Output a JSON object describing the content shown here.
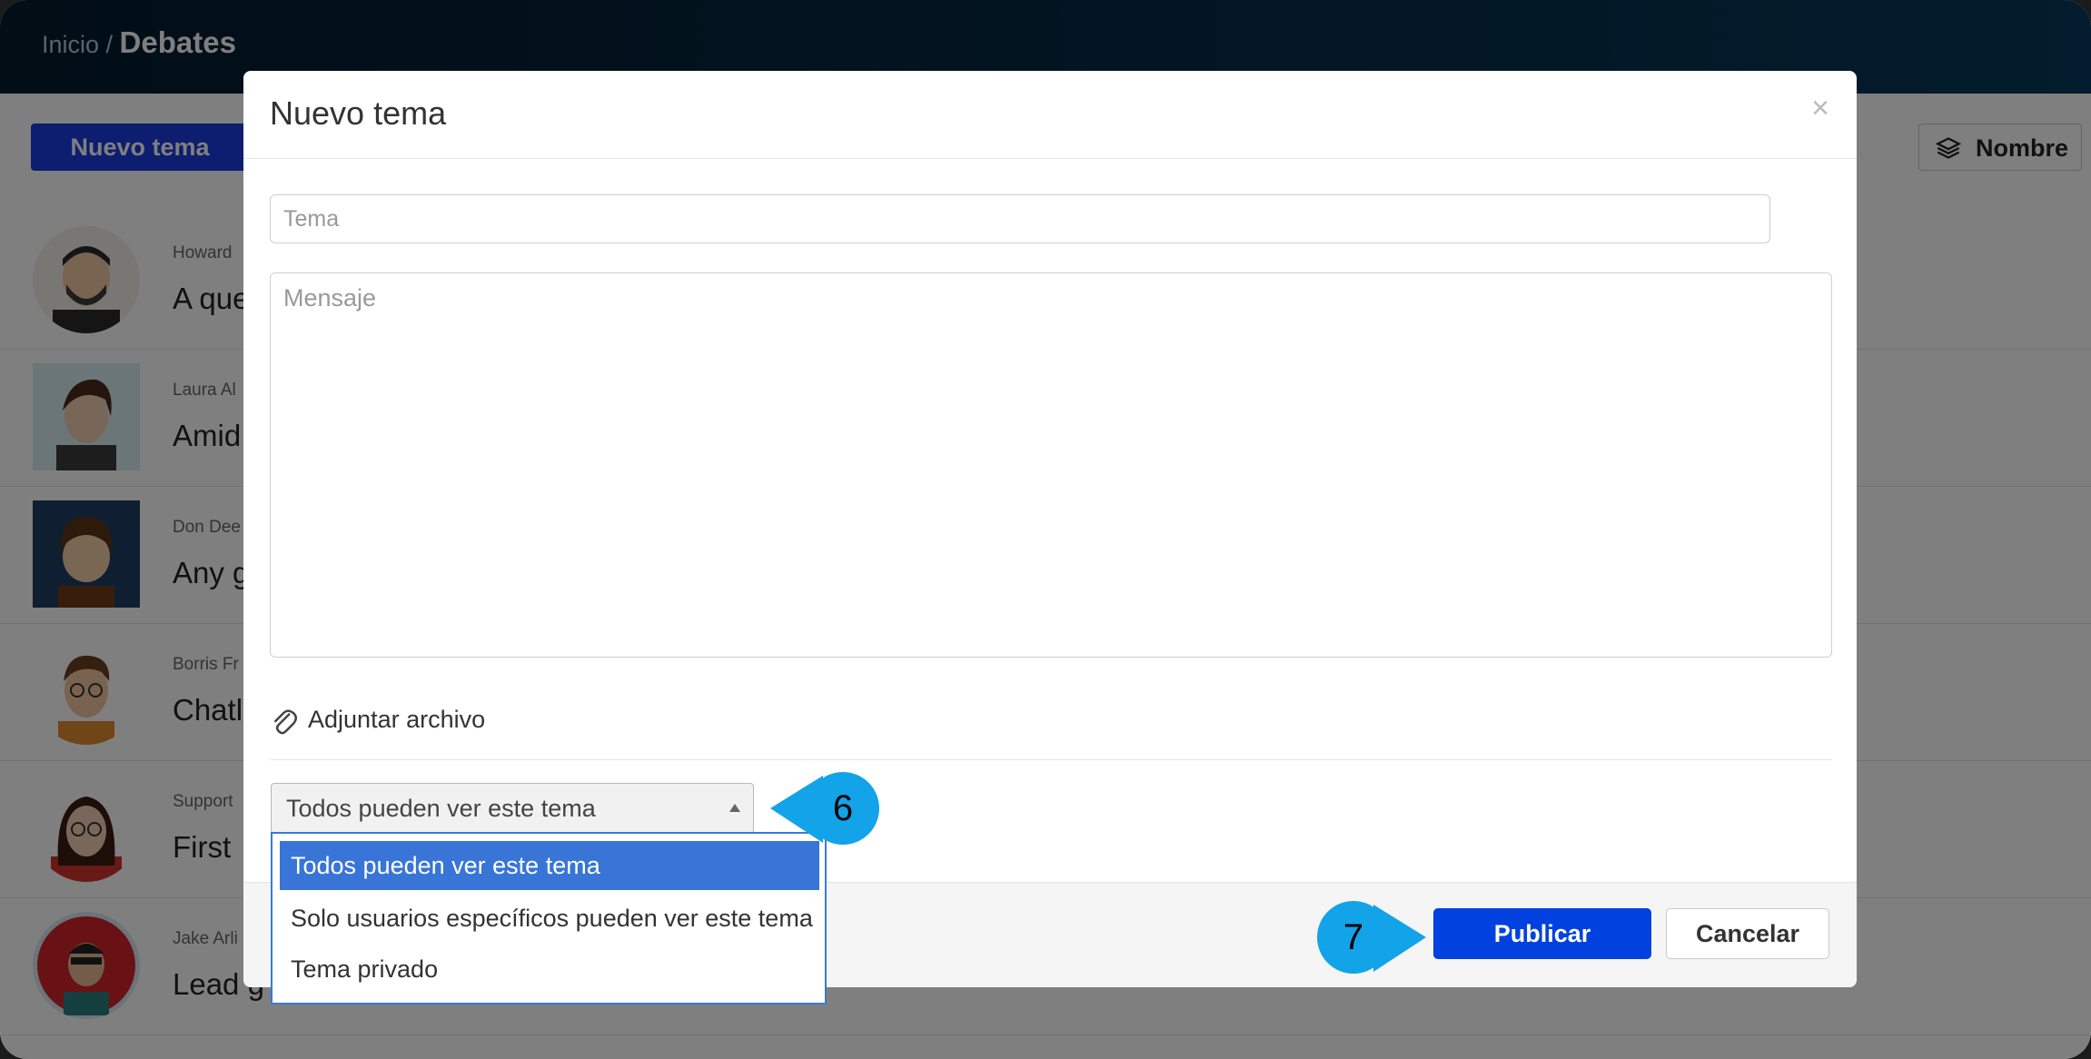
{
  "breadcrumb": {
    "root": "Inicio",
    "separator": " / ",
    "current": "Debates"
  },
  "toolbar": {
    "new_topic_label": "Nuevo tema",
    "sort_label": "Nombre",
    "sort_icon": "layers-icon"
  },
  "topics": [
    {
      "author": "Howard",
      "title": "A que"
    },
    {
      "author": "Laura Al",
      "title": "Amid"
    },
    {
      "author": "Don Dee",
      "title": "Any g"
    },
    {
      "author": "Borris Fr",
      "title": "Chatl"
    },
    {
      "author": "Support",
      "title": "First"
    },
    {
      "author": "Jake Arli",
      "title": "Lead g"
    }
  ],
  "modal": {
    "title": "Nuevo tema",
    "close_label": "×",
    "subject_placeholder": "Tema",
    "message_placeholder": "Mensaje",
    "attach_label": "Adjuntar archivo",
    "visibility": {
      "selected": "Todos pueden ver este tema",
      "options": [
        "Todos pueden ver este tema",
        "Solo usuarios específicos pueden ver este tema",
        "Tema privado"
      ]
    },
    "publish_label": "Publicar",
    "cancel_label": "Cancelar"
  },
  "callouts": {
    "step6": "6",
    "step7": "7",
    "color": "#12a3e8"
  },
  "colors": {
    "primary_button": "#0041e0",
    "highlight": "#3875d7",
    "header": "#08385a"
  }
}
